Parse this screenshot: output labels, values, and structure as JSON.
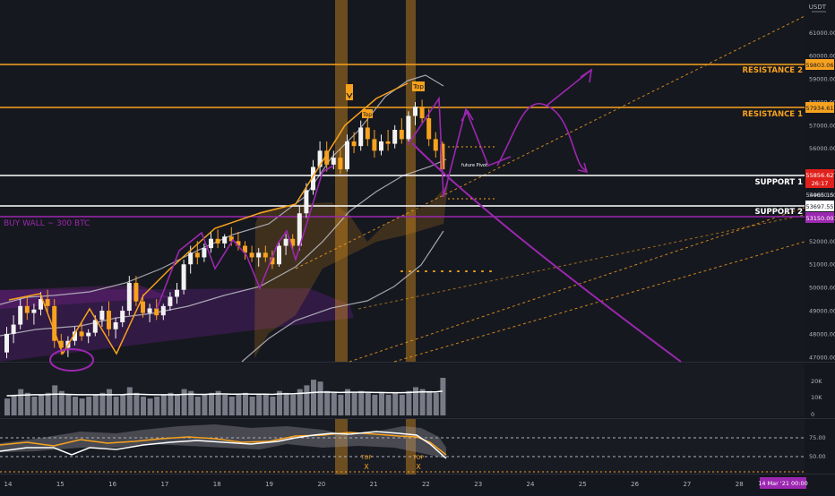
{
  "header": {
    "currency": "USDT"
  },
  "levels": [
    {
      "name": "RESISTANCE 2",
      "price": "59803.06",
      "color": "#f7a21e"
    },
    {
      "name": "RESISTANCE 1",
      "price": "57934.61",
      "color": "#f7a21e"
    },
    {
      "name": "SUPPORT 1",
      "price": "55856.62",
      "color": "#ffffff"
    },
    {
      "name": "SUPPORT 2",
      "price": "53697.55",
      "color": "#ffffff"
    }
  ],
  "buy_wall": {
    "label": "BUY WALL ~ 300 BTC",
    "price": "53150.00",
    "color": "#9c27b0"
  },
  "last_price": {
    "value": "55856.62",
    "countdown": "26:17",
    "color": "#e0201b"
  },
  "price_label_54965": "54965.15",
  "annotations": {
    "top_1": "Top",
    "top_2": "Top",
    "future_pivot": "future Pivot",
    "x_marks": [
      "X",
      "X"
    ],
    "rsi_top_labels": [
      "TOP",
      "TOP"
    ]
  },
  "date_badge": "14 Mar '21   00:00",
  "chart_data": {
    "type": "candlestick",
    "symbol_quote": "USDT",
    "x_axis": {
      "ticks": [
        "14",
        "15",
        "16",
        "17",
        "18",
        "19",
        "20",
        "21",
        "22",
        "23",
        "24",
        "25",
        "26",
        "27",
        "28"
      ]
    },
    "y_axis": {
      "ticks": [
        47000,
        48000,
        49000,
        50000,
        51000,
        52000,
        53000,
        54000,
        55000,
        56000,
        57000,
        58000,
        59000,
        60000,
        61000
      ],
      "range": [
        46800,
        62400
      ]
    },
    "volume_axis": {
      "ticks": [
        "20K",
        "10K",
        "0"
      ]
    },
    "rsi_axis": {
      "ticks": [
        "75.00",
        "50.00"
      ]
    },
    "candles": [
      {
        "o": 47200,
        "h": 48300,
        "l": 46950,
        "c": 48000
      },
      {
        "o": 48000,
        "h": 48800,
        "l": 47600,
        "c": 48400
      },
      {
        "o": 48400,
        "h": 49500,
        "l": 48200,
        "c": 49200
      },
      {
        "o": 49200,
        "h": 49600,
        "l": 48600,
        "c": 48900
      },
      {
        "o": 48900,
        "h": 49300,
        "l": 48400,
        "c": 49050
      },
      {
        "o": 49050,
        "h": 49800,
        "l": 48800,
        "c": 49500
      },
      {
        "o": 49500,
        "h": 49900,
        "l": 48900,
        "c": 49200
      },
      {
        "o": 49200,
        "h": 49500,
        "l": 47400,
        "c": 47700
      },
      {
        "o": 47700,
        "h": 48000,
        "l": 47100,
        "c": 47400
      },
      {
        "o": 47400,
        "h": 47900,
        "l": 47000,
        "c": 47700
      },
      {
        "o": 47700,
        "h": 48300,
        "l": 47500,
        "c": 48100
      },
      {
        "o": 48100,
        "h": 48500,
        "l": 47700,
        "c": 47900
      },
      {
        "o": 47900,
        "h": 48200,
        "l": 47600,
        "c": 48050
      },
      {
        "o": 48050,
        "h": 48800,
        "l": 47900,
        "c": 48600
      },
      {
        "o": 48600,
        "h": 49200,
        "l": 48300,
        "c": 49000
      },
      {
        "o": 49000,
        "h": 49400,
        "l": 47900,
        "c": 48200
      },
      {
        "o": 48200,
        "h": 48700,
        "l": 47800,
        "c": 48500
      },
      {
        "o": 48500,
        "h": 49200,
        "l": 48300,
        "c": 49000
      },
      {
        "o": 49000,
        "h": 50500,
        "l": 48800,
        "c": 50200
      },
      {
        "o": 50200,
        "h": 50500,
        "l": 49200,
        "c": 49400
      },
      {
        "o": 49400,
        "h": 49700,
        "l": 48700,
        "c": 48900
      },
      {
        "o": 48900,
        "h": 49300,
        "l": 48500,
        "c": 49100
      },
      {
        "o": 49100,
        "h": 49500,
        "l": 48600,
        "c": 48800
      },
      {
        "o": 48800,
        "h": 49300,
        "l": 48600,
        "c": 49200
      },
      {
        "o": 49200,
        "h": 49800,
        "l": 49000,
        "c": 49600
      },
      {
        "o": 49600,
        "h": 50200,
        "l": 49300,
        "c": 49900
      },
      {
        "o": 49900,
        "h": 51200,
        "l": 49700,
        "c": 51000
      },
      {
        "o": 51000,
        "h": 51800,
        "l": 50600,
        "c": 51500
      },
      {
        "o": 51500,
        "h": 52000,
        "l": 51000,
        "c": 51300
      },
      {
        "o": 51300,
        "h": 51900,
        "l": 51100,
        "c": 51700
      },
      {
        "o": 51700,
        "h": 52400,
        "l": 51500,
        "c": 52100
      },
      {
        "o": 52100,
        "h": 52500,
        "l": 51700,
        "c": 51900
      },
      {
        "o": 51900,
        "h": 52300,
        "l": 51700,
        "c": 52200
      },
      {
        "o": 52200,
        "h": 52600,
        "l": 51800,
        "c": 52000
      },
      {
        "o": 52000,
        "h": 52400,
        "l": 51600,
        "c": 51800
      },
      {
        "o": 51800,
        "h": 52000,
        "l": 51200,
        "c": 51500
      },
      {
        "o": 51500,
        "h": 51800,
        "l": 51100,
        "c": 51300
      },
      {
        "o": 51300,
        "h": 51700,
        "l": 50900,
        "c": 51500
      },
      {
        "o": 51500,
        "h": 51800,
        "l": 51100,
        "c": 51300
      },
      {
        "o": 51300,
        "h": 51600,
        "l": 50800,
        "c": 51000
      },
      {
        "o": 51000,
        "h": 52000,
        "l": 50900,
        "c": 51800
      },
      {
        "o": 51800,
        "h": 52300,
        "l": 51400,
        "c": 52100
      },
      {
        "o": 52100,
        "h": 52300,
        "l": 51600,
        "c": 51800
      },
      {
        "o": 51800,
        "h": 53500,
        "l": 51600,
        "c": 53200
      },
      {
        "o": 53200,
        "h": 54500,
        "l": 53000,
        "c": 54200
      },
      {
        "o": 54200,
        "h": 55500,
        "l": 54000,
        "c": 55200
      },
      {
        "o": 55200,
        "h": 56300,
        "l": 54900,
        "c": 55900
      },
      {
        "o": 55900,
        "h": 56300,
        "l": 55000,
        "c": 55300
      },
      {
        "o": 55300,
        "h": 55900,
        "l": 55100,
        "c": 55600
      },
      {
        "o": 55600,
        "h": 56000,
        "l": 54900,
        "c": 55100
      },
      {
        "o": 55100,
        "h": 56600,
        "l": 55000,
        "c": 56300
      },
      {
        "o": 56300,
        "h": 56700,
        "l": 55800,
        "c": 56100
      },
      {
        "o": 56100,
        "h": 57200,
        "l": 55900,
        "c": 56900
      },
      {
        "o": 56900,
        "h": 57500,
        "l": 56100,
        "c": 56400
      },
      {
        "o": 56400,
        "h": 56800,
        "l": 55600,
        "c": 55900
      },
      {
        "o": 55900,
        "h": 56600,
        "l": 55700,
        "c": 56300
      },
      {
        "o": 56300,
        "h": 56800,
        "l": 55900,
        "c": 56200
      },
      {
        "o": 56200,
        "h": 57000,
        "l": 56000,
        "c": 56800
      },
      {
        "o": 56800,
        "h": 57300,
        "l": 56200,
        "c": 56400
      },
      {
        "o": 56400,
        "h": 57600,
        "l": 56300,
        "c": 57400
      },
      {
        "o": 57400,
        "h": 58000,
        "l": 57000,
        "c": 57800
      },
      {
        "o": 57800,
        "h": 58100,
        "l": 57100,
        "c": 57300
      },
      {
        "o": 57300,
        "h": 57700,
        "l": 56100,
        "c": 56400
      },
      {
        "o": 56400,
        "h": 56700,
        "l": 55600,
        "c": 55900
      },
      {
        "o": 56200,
        "h": 56300,
        "l": 54700,
        "c": 55100
      }
    ],
    "volume": [
      9,
      11,
      14,
      12,
      10,
      11,
      12,
      16,
      13,
      11,
      10,
      9,
      10,
      11,
      12,
      14,
      10,
      11,
      15,
      12,
      10,
      9,
      10,
      11,
      12,
      11,
      14,
      13,
      10,
      11,
      12,
      13,
      11,
      10,
      11,
      12,
      10,
      11,
      11,
      10,
      13,
      12,
      11,
      14,
      16,
      19,
      18,
      13,
      12,
      11,
      14,
      12,
      13,
      12,
      11,
      12,
      11,
      12,
      11,
      13,
      15,
      14,
      13,
      12,
      20
    ],
    "volume_ma": [
      10.5,
      10.6,
      10.8,
      10.9,
      11,
      11,
      11.1,
      11.3,
      11.3,
      11.2,
      11.1,
      11,
      11,
      11,
      11,
      11.1,
      11,
      11.1,
      11.3,
      11.3,
      11.2,
      11.1,
      11,
      11,
      11,
      11,
      11.2,
      11.3,
      11.2,
      11.2,
      11.3,
      11.4,
      11.4,
      11.3,
      11.3,
      11.4,
      11.3,
      11.3,
      11.3,
      11.2,
      11.4,
      11.5,
      11.5,
      11.7,
      11.9,
      12.2,
      12.4,
      12.4,
      12.3,
      12.2,
      12.3,
      12.3,
      12.3,
      12.3,
      12.2,
      12.2,
      12.1,
      12.1,
      12.1,
      12.2,
      12.4,
      12.5,
      12.5,
      12.5,
      12.9
    ]
  }
}
